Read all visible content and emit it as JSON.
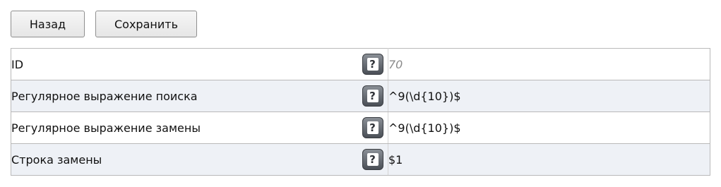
{
  "toolbar": {
    "back_label": "Назад",
    "save_label": "Сохранить"
  },
  "form": {
    "help_glyph": "?",
    "rows": [
      {
        "label": "ID",
        "value": "70",
        "value_style": "placeholder"
      },
      {
        "label": "Регулярное выражение поиска",
        "value": "^9(\\d{10})$",
        "value_style": "text"
      },
      {
        "label": "Регулярное выражение замены",
        "value": "^9(\\d{10})$",
        "value_style": "text"
      },
      {
        "label": "Строка замены",
        "value": "$1",
        "value_style": "text"
      }
    ]
  },
  "colors": {
    "row_alt_background": "#eef1f6",
    "border": "#b9b9b9"
  }
}
